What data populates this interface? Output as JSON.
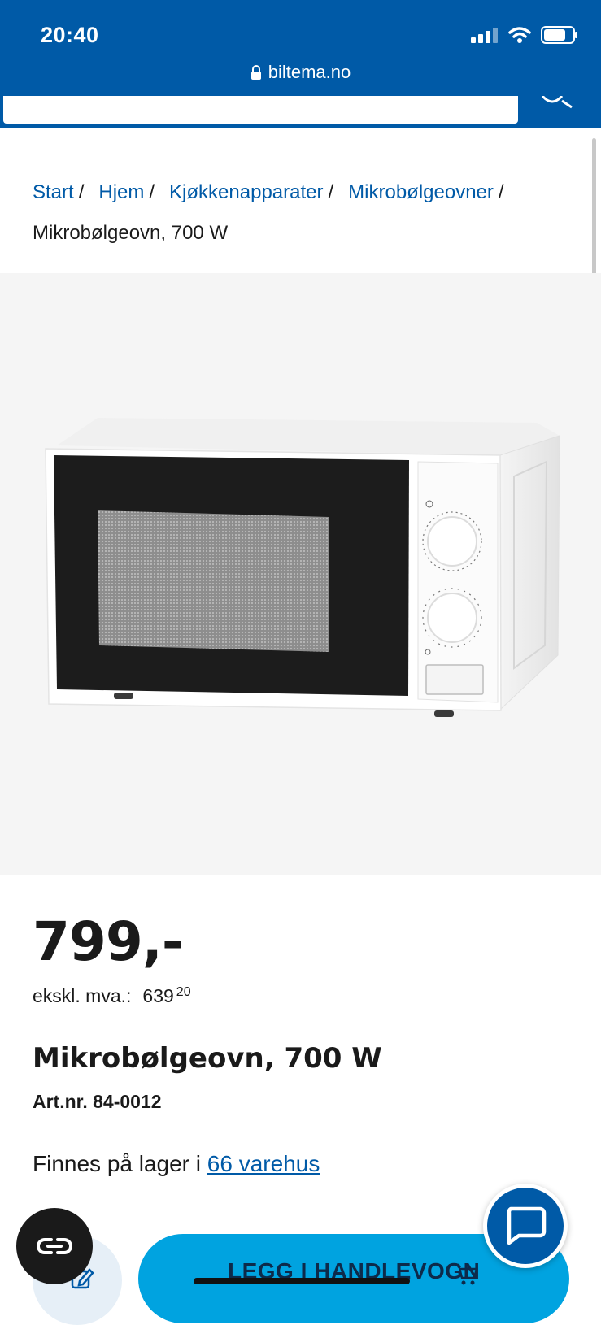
{
  "status_bar": {
    "time": "20:40"
  },
  "browser": {
    "url": "biltema.no"
  },
  "breadcrumb": {
    "items": [
      "Start",
      "Hjem",
      "Kjøkkenapparater",
      "Mikrobølgeovner"
    ],
    "separator": "/",
    "current": "Mikrobølgeovn, 700 W"
  },
  "product": {
    "price": "799,-",
    "ex_vat_label": "ekskl. mva.:",
    "ex_vat_whole": "639",
    "ex_vat_cents": "20",
    "title": "Mikrobølgeovn, 700 W",
    "artnr": "Art.nr. 84-0012",
    "stock_prefix": "Finnes på lager i",
    "stock_link": "66 varehus"
  },
  "actions": {
    "add_to_cart": "LEGG I HANDLEVOGN"
  },
  "icons": {
    "search": "search-icon",
    "lock": "lock-icon",
    "compare": "compare-icon",
    "edit": "edit-icon",
    "cart": "cart-icon",
    "chat": "chat-icon"
  },
  "colors": {
    "brand": "#005aa7",
    "cta": "#00a3e0",
    "image_bg": "#f5f5f5"
  }
}
